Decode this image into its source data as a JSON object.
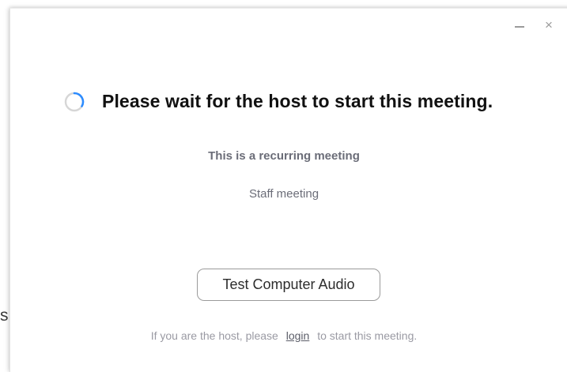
{
  "background": {
    "fragment_text": "s"
  },
  "window": {
    "controls": {
      "minimize_icon": "minimize-icon",
      "close_icon": "close-icon",
      "close_glyph": "×"
    },
    "status": {
      "spinner_icon": "loading-spinner-icon",
      "title": "Please wait for the host to start this meeting."
    },
    "meeting": {
      "type_label": "This is a recurring meeting",
      "topic": "Staff meeting"
    },
    "audio_button_label": "Test Computer Audio",
    "host_note": {
      "prefix": "If you are the host, please",
      "link": "login",
      "suffix": "to start this meeting."
    }
  },
  "colors": {
    "spinner_accent": "#2d8cff",
    "spinner_track": "#d6d6d6",
    "title_text": "#111111",
    "secondary_text": "#6b6d78"
  }
}
